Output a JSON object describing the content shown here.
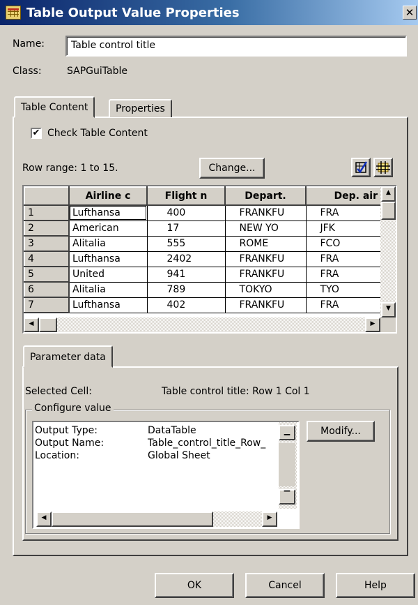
{
  "window": {
    "title": "Table Output Value Properties",
    "close_glyph": "✕"
  },
  "name_label": "Name:",
  "name_value": "Table control title",
  "class_label": "Class:",
  "class_value": "SAPGuiTable",
  "tabs": [
    {
      "label": "Table Content",
      "active": true
    },
    {
      "label": "Properties",
      "active": false
    }
  ],
  "check_table_content": {
    "label": "Check Table Content",
    "checked": true
  },
  "row_range_text": "Row range: 1 to 15.",
  "change_button": "Change...",
  "grid": {
    "columns": [
      "Airline c",
      "Flight n",
      "Depart.",
      "Dep. air"
    ],
    "rows": [
      {
        "num": "1",
        "cells": [
          "Lufthansa",
          "400",
          "FRANKFU",
          "FRA"
        ]
      },
      {
        "num": "2",
        "cells": [
          "American",
          "17",
          "NEW YO",
          "JFK"
        ]
      },
      {
        "num": "3",
        "cells": [
          "Alitalia",
          "555",
          "ROME",
          "FCO"
        ]
      },
      {
        "num": "4",
        "cells": [
          "Lufthansa",
          "2402",
          "FRANKFU",
          "FRA"
        ]
      },
      {
        "num": "5",
        "cells": [
          "United",
          "941",
          "FRANKFU",
          "FRA"
        ]
      },
      {
        "num": "6",
        "cells": [
          "Alitalia",
          "789",
          "TOKYO",
          "TYO"
        ]
      },
      {
        "num": "7",
        "cells": [
          "Lufthansa",
          "402",
          "FRANKFU",
          "FRA"
        ]
      }
    ]
  },
  "parameter_tab": "Parameter data",
  "selected_cell_label": "Selected Cell:",
  "selected_cell_value": "Table control title: Row 1 Col 1",
  "configure_value": {
    "label": "Configure value",
    "rows": [
      {
        "key": "Output Type:",
        "value": "DataTable"
      },
      {
        "key": "Output Name:",
        "value": "Table_control_title_Row_"
      },
      {
        "key": "Location:",
        "value": "Global Sheet"
      }
    ],
    "modify_button": "Modify..."
  },
  "footer": {
    "ok": "OK",
    "cancel": "Cancel",
    "help": "Help"
  }
}
